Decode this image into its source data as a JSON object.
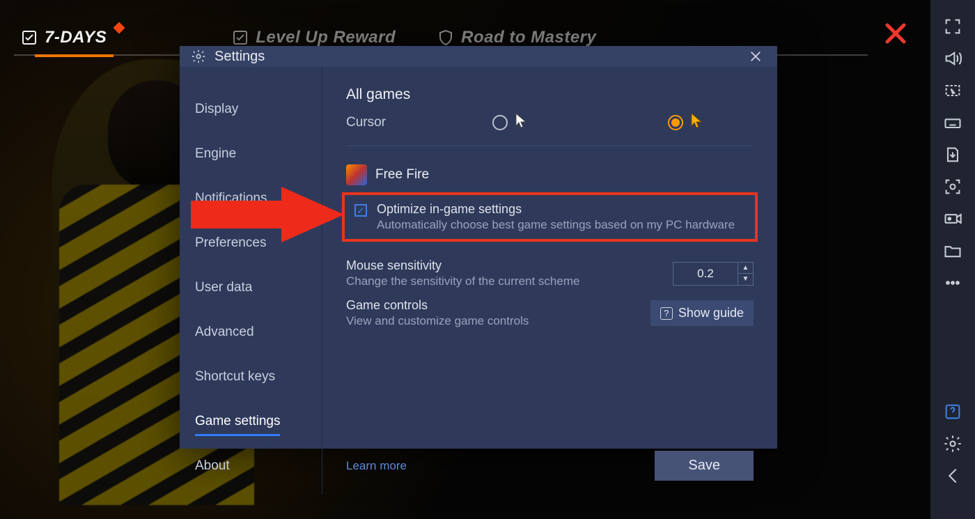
{
  "topTabs": {
    "items": [
      {
        "label": "7-DAYS"
      },
      {
        "label": "Level Up Reward"
      },
      {
        "label": "Road to Mastery"
      }
    ]
  },
  "settings": {
    "title": "Settings",
    "sidebar": [
      {
        "label": "Display"
      },
      {
        "label": "Engine"
      },
      {
        "label": "Notifications"
      },
      {
        "label": "Preferences"
      },
      {
        "label": "User data"
      },
      {
        "label": "Advanced"
      },
      {
        "label": "Shortcut keys"
      },
      {
        "label": "Game settings"
      },
      {
        "label": "About"
      }
    ],
    "content": {
      "allGamesTitle": "All games",
      "cursorLabel": "Cursor",
      "gameName": "Free Fire",
      "optimize": {
        "title": "Optimize in-game settings",
        "desc": "Automatically choose best game settings based on my PC hardware",
        "checked": true
      },
      "mouse": {
        "title": "Mouse sensitivity",
        "desc": "Change the sensitivity of the current scheme",
        "value": "0.2"
      },
      "controls": {
        "title": "Game controls",
        "desc": "View and customize game controls",
        "button": "Show guide"
      },
      "learnMore": "Learn more",
      "save": "Save"
    }
  }
}
